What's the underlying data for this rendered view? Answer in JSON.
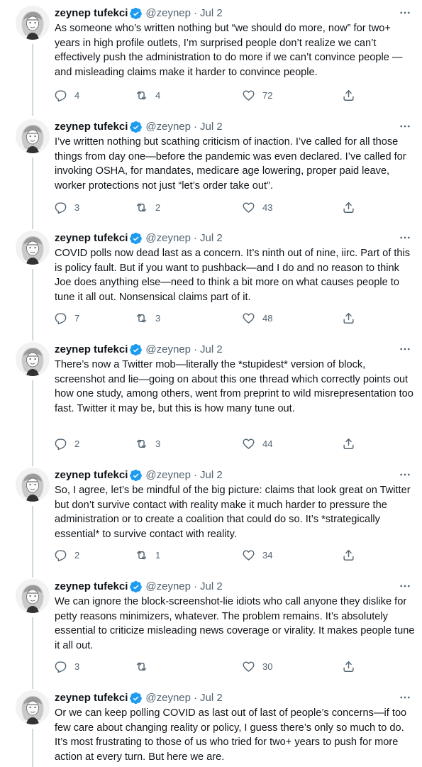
{
  "author": {
    "name": "zeynep tufekci",
    "handle": "@zeynep",
    "date": "Jul 2",
    "separator": "·",
    "verified": true
  },
  "icons": {
    "verified": "verified-badge-icon",
    "more": "more-options-icon",
    "reply": "reply-icon",
    "retweet": "retweet-icon",
    "like": "like-heart-icon",
    "share": "share-icon"
  },
  "colors": {
    "verified": "#1d9bf0",
    "text": "#0f1419",
    "secondary": "#536471",
    "thread_line": "#cfd9de"
  },
  "tweets": [
    {
      "text": "As someone who’s written nothing but “we should do more, now” for two+ years in high profile outlets, I’m surprised people don’t realize we can’t effectively push the administration to do more if we can’t convince people —and misleading claims make it harder to convince people.",
      "replies": "4",
      "retweets": "4",
      "likes": "72"
    },
    {
      "text": "I’ve written nothing but scathing criticism of inaction. I’ve called for all those things from day one—before the pandemic was even declared. I’ve called for invoking OSHA, for mandates, medicare age lowering, proper paid leave, worker protections not just “let’s order take out”.",
      "replies": "3",
      "retweets": "2",
      "likes": "43"
    },
    {
      "text": "COVID polls now dead last as a concern. It’s ninth out of nine, iirc. Part of this is policy fault. But if you want to pushback—and I do and no reason to think Joe does anything else—need to think a bit more on what causes people to tune it all out. Nonsensical claims part of it.",
      "replies": "7",
      "retweets": "3",
      "likes": "48"
    },
    {
      "text": "There’s now a Twitter mob—literally the *stupidest* version of block, screenshot and lie—going on about this one thread which correctly points out how one study, among others, went from preprint to wild misrepresentation too fast. Twitter it may be, but this is how many tune out.",
      "replies": "2",
      "retweets": "3",
      "likes": "44"
    },
    {
      "text": "So, I agree, let’s be mindful of the big picture: claims that look great on Twitter but don’t survive contact with reality make it much harder to pressure the administration or to create a coalition that could do so. It’s *strategically essential* to survive contact with reality.",
      "replies": "2",
      "retweets": "1",
      "likes": "34"
    },
    {
      "text": "We can ignore the block-screenshot-lie idiots who call anyone they dislike for petty reasons minimizers, whatever. The problem remains. It’s absolutely essential to criticize misleading news coverage or virality. It makes people tune it all out.",
      "replies": "3",
      "retweets": "",
      "likes": "30"
    },
    {
      "text": "Or we can keep polling COVID as last out of last of people’s concerns—if too few care about changing reality or policy, I guess there’s only so much to do. It’s most frustrating to those of us who tried for two+ years to push for more action at every turn. But here we are.",
      "replies": "",
      "retweets": "",
      "likes": ""
    }
  ]
}
